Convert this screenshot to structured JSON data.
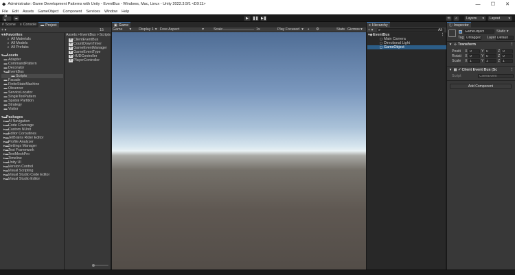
{
  "window": {
    "title": "Administrator: Game Development Patterns with Unity - EventBus - Windows, Mac, Linux - Unity 2022.3.5f1 <DX11>",
    "controls": [
      "—",
      "☐",
      "✕"
    ]
  },
  "menu": [
    "File",
    "Edit",
    "Assets",
    "GameObject",
    "Component",
    "Services",
    "Window",
    "Help"
  ],
  "toolbar": {
    "account_label": "⚙ ▾",
    "cloud_label": "☁",
    "play": "▶",
    "pause": "❚❚",
    "step": "▶❚",
    "history_icon": "⟲",
    "search_icon": "⌕",
    "layers": "Layers",
    "layout": "Layout"
  },
  "left_tabs": {
    "scene": "Scene",
    "console": "Console",
    "project": "Project"
  },
  "project": {
    "add_label": "+ ▾",
    "slider_value": "15",
    "breadcrumb": [
      "Assets",
      "EventBus",
      "Scripts"
    ],
    "favorites_label": "Favorites",
    "favorites": [
      "All Materials",
      "All Models",
      "All Prefabs"
    ],
    "assets_label": "Assets",
    "assets": [
      "Adapter",
      "CommandPattern",
      "Decorator",
      "EventBus",
      "Scripts",
      "Facade",
      "FiniteStateMachine",
      "Observer",
      "ServiceLocator",
      "SingleTonPattern",
      "Spatial Partition",
      "Strategy",
      "Visitor"
    ],
    "packages_label": "Packages",
    "packages": [
      "AI Navigation",
      "Code Coverage",
      "Custom NUnit",
      "Editor Coroutines",
      "JetBrains Rider Editor",
      "Profile Analyzer",
      "Settings Manager",
      "Test Framework",
      "TextMeshPro",
      "Timeline",
      "Unity UI",
      "Version Control",
      "Visual Scripting",
      "Visual Studio Code Editor",
      "Visual Studio Editor"
    ],
    "files": [
      "ClientEventBus",
      "CountDownTimer",
      "GameEventManager",
      "GameEventType",
      "HUDController",
      "PlayerController"
    ]
  },
  "game": {
    "tab": "Game",
    "display_mode": "Game",
    "display": "Display 1",
    "aspect": "Free Aspect",
    "scale_label": "Scale",
    "scale_value": "1x",
    "play_mode": "Play Focused",
    "stats": "Stats",
    "gizmos": "Gizmos"
  },
  "hierarchy": {
    "tab": "Hierarchy",
    "add_label": "+ ▾",
    "all_label": "All",
    "scene": "EventBus",
    "objects": [
      "Main Camera",
      "Directional Light",
      "GameObject"
    ]
  },
  "inspector": {
    "tab": "Inspector",
    "object_name": "GameObject",
    "static_label": "Static ▾",
    "tag_label": "Tag",
    "tag_value": "Untagged",
    "layer_label": "Layer",
    "layer_value": "Default",
    "transform_label": "Transform",
    "position_label": "Positi",
    "rotation_label": "Rotati",
    "scale_label": "Scale",
    "position": [
      "0",
      "0",
      "0"
    ],
    "rotation": [
      "0",
      "0",
      "0"
    ],
    "scale": [
      "1",
      "1",
      "1"
    ],
    "axis": [
      "X",
      "Y",
      "Z"
    ],
    "component_label": "Client Event Bus (Sc",
    "script_label": "Script",
    "script_value": "ClientEvent",
    "add_component": "Add Component"
  },
  "colors": {
    "accent": "#2c5d87",
    "panel": "#383838",
    "background": "#191919",
    "sky_top": "#4f6d95",
    "horizon": "#e9f1f4",
    "ground": "#5f5852"
  }
}
